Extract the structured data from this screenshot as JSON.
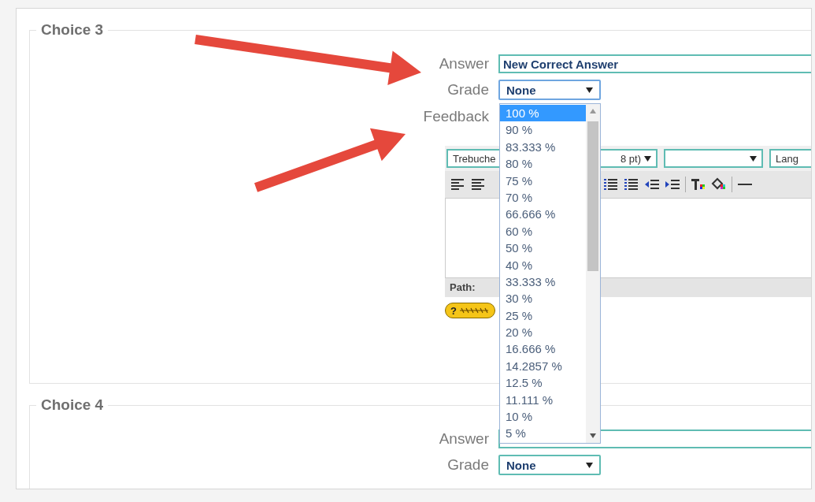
{
  "choices": [
    {
      "legend": "Choice 3",
      "answer": {
        "label": "Answer",
        "value": "New Correct Answer"
      },
      "grade": {
        "label": "Grade",
        "value": "None",
        "expanded": true,
        "options": [
          {
            "label": "100 %",
            "selected": true
          },
          {
            "label": "90 %",
            "selected": false
          },
          {
            "label": "83.333 %",
            "selected": false
          },
          {
            "label": "80 %",
            "selected": false
          },
          {
            "label": "75 %",
            "selected": false
          },
          {
            "label": "70 %",
            "selected": false
          },
          {
            "label": "66.666 %",
            "selected": false
          },
          {
            "label": "60 %",
            "selected": false
          },
          {
            "label": "50 %",
            "selected": false
          },
          {
            "label": "40 %",
            "selected": false
          },
          {
            "label": "33.333 %",
            "selected": false
          },
          {
            "label": "30 %",
            "selected": false
          },
          {
            "label": "25 %",
            "selected": false
          },
          {
            "label": "20 %",
            "selected": false
          },
          {
            "label": "16.666 %",
            "selected": false
          },
          {
            "label": "14.2857 %",
            "selected": false
          },
          {
            "label": "12.5 %",
            "selected": false
          },
          {
            "label": "11.111 %",
            "selected": false
          },
          {
            "label": "10 %",
            "selected": false
          },
          {
            "label": "5 %",
            "selected": false
          }
        ]
      },
      "feedback": {
        "label": "Feedback",
        "editor": {
          "font": "Trebuche",
          "size": "8 pt)",
          "lang": "Lang",
          "path_label": "Path:",
          "help_glyph": "?"
        }
      }
    },
    {
      "legend": "Choice 4",
      "answer": {
        "label": "Answer"
      },
      "grade": {
        "label": "Grade",
        "value": "None",
        "expanded": false
      }
    }
  ]
}
